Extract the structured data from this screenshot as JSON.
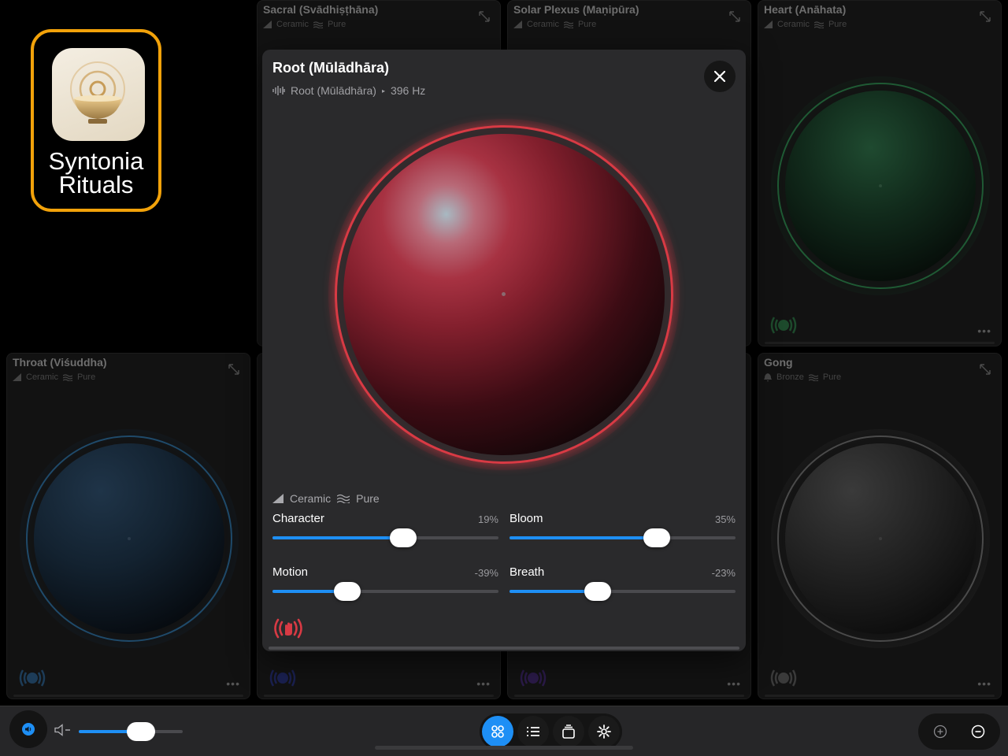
{
  "app": {
    "name_line1": "Syntonia",
    "name_line2": "Rituals"
  },
  "tiles": {
    "sacral": {
      "title": "Sacral (Svādhiṣṭhāna)",
      "material": "Ceramic",
      "tone": "Pure"
    },
    "solar": {
      "title": "Solar Plexus (Maṇipūra)",
      "material": "Ceramic",
      "tone": "Pure"
    },
    "heart": {
      "title": "Heart (Anāhata)",
      "material": "Ceramic",
      "tone": "Pure"
    },
    "throat": {
      "title": "Throat (Viśuddha)",
      "material": "Ceramic",
      "tone": "Pure"
    },
    "gong": {
      "title": "Gong",
      "material": "Bronze",
      "tone": "Pure"
    },
    "more_label": "•••"
  },
  "modal": {
    "title": "Root (Mūlādhāra)",
    "subtitle_name": "Root (Mūlādhāra)",
    "subtitle_separator": "▸",
    "subtitle_freq": "396 Hz",
    "material": "Ceramic",
    "tone": "Pure",
    "accent_color": "#d83a44",
    "sliders": {
      "character": {
        "label": "Character",
        "value_text": "19%",
        "fill_fraction": 0.58
      },
      "bloom": {
        "label": "Bloom",
        "value_text": "35%",
        "fill_fraction": 0.65
      },
      "motion": {
        "label": "Motion",
        "value_text": "-39%",
        "fill_fraction": 0.33
      },
      "breath": {
        "label": "Breath",
        "value_text": "-23%",
        "fill_fraction": 0.39
      }
    }
  },
  "toolbar": {
    "volume_fraction": 0.6,
    "accent_color": "#1e8ff5",
    "nav": [
      "grid-icon",
      "list-icon",
      "stack-icon",
      "gear-icon"
    ],
    "zoom": [
      "zoom-in-icon",
      "zoom-out-icon"
    ]
  }
}
